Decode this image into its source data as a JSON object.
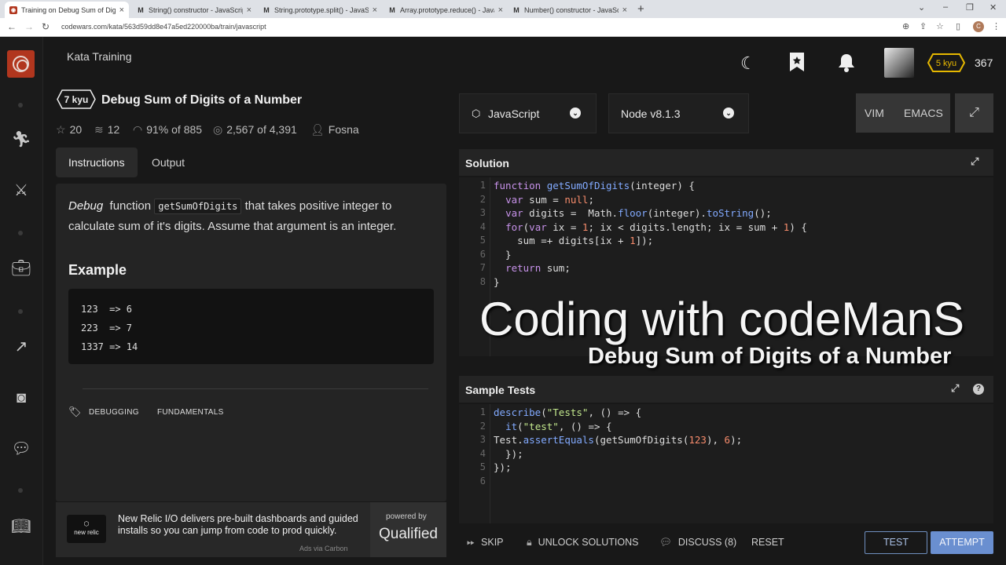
{
  "browser": {
    "tabs": [
      {
        "title": "Training on Debug Sum of Digits",
        "icon": "codewars-favicon",
        "active": true
      },
      {
        "title": "String() constructor - JavaScript |",
        "icon": "mdn-favicon"
      },
      {
        "title": "String.prototype.split() - JavaScri",
        "icon": "mdn-favicon"
      },
      {
        "title": "Array.prototype.reduce() - JavaSc",
        "icon": "mdn-favicon"
      },
      {
        "title": "Number() constructor - JavaScrip",
        "icon": "mdn-favicon"
      }
    ],
    "url": "codewars.com/kata/563d59dd8e47a5ed220000ba/train/javascript",
    "profile_initial": "C"
  },
  "header": {
    "section_title": "Kata Training",
    "rank_label": "5 kyu",
    "honor": "367"
  },
  "kata": {
    "rank": "7 kyu",
    "title": "Debug Sum of Digits of a Number",
    "stats": {
      "stars": "20",
      "collections": "12",
      "satisfaction": "91%",
      "satisfaction_votes": "885",
      "completed": "2,567",
      "attempted": "4,391",
      "author": "Fosna",
      "of": "of"
    }
  },
  "left_tabs": {
    "instructions": "Instructions",
    "output": "Output"
  },
  "instructions": {
    "word_debug": "Debug",
    "word_function": "function",
    "fn_name": "getSumOfDigits",
    "rest": "that takes positive integer to calculate sum of it's digits. Assume that argument is an integer.",
    "example_heading": "Example",
    "example_code": "123  => 6\n223  => 7\n1337 => 14"
  },
  "tags": [
    "DEBUGGING",
    "FUNDAMENTALS"
  ],
  "ad": {
    "logo_text": "new relic",
    "text": "New Relic I/O delivers pre-built dashboards and guided installs so you can jump from code to prod quickly.",
    "via": "Ads via Carbon",
    "powered_by": "powered by",
    "brand": "Qualified"
  },
  "editor_controls": {
    "language": "JavaScript",
    "version": "Node v8.1.3",
    "vim": "VIM",
    "emacs": "EMACS"
  },
  "solution": {
    "heading": "Solution",
    "line_numbers": [
      "1",
      "2",
      "3",
      "4",
      "5",
      "6",
      "7",
      "8"
    ]
  },
  "sample_tests": {
    "heading": "Sample Tests",
    "line_numbers": [
      "1",
      "2",
      "3",
      "4",
      "5",
      "6"
    ]
  },
  "overlay": {
    "line1": "Coding with codeManS",
    "line2": "Debug Sum of Digits of a Number"
  },
  "actions": {
    "skip": "SKIP",
    "unlock": "UNLOCK SOLUTIONS",
    "discuss": "DISCUSS (8)",
    "reset": "RESET",
    "test": "TEST",
    "attempt": "ATTEMPT"
  }
}
